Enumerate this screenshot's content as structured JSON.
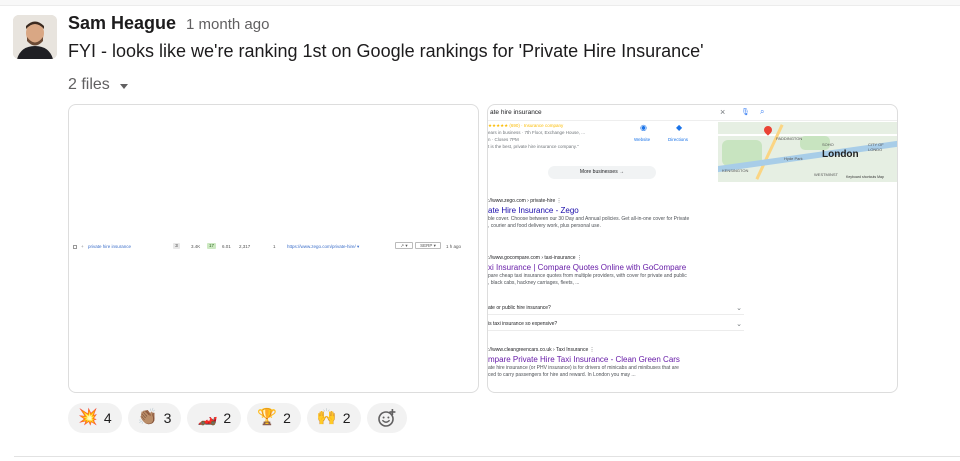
{
  "message": {
    "author": "Sam Heague",
    "timestamp": "1 month ago",
    "text": "FYI - looks like we're ranking 1st on Google rankings for 'Private Hire Insurance'",
    "files_label": "2 files"
  },
  "file1": {
    "keyword": "private hire insurance",
    "kd": "3",
    "volume": "3.4K",
    "tp": "17",
    "cpc": "6.01",
    "traffic": "2,317",
    "position": "1",
    "url": "https://www.zego.com/private-hire/ ▾",
    "chart_btn": "↗ ▾",
    "serp_btn": "SERP ▾",
    "updated": "1 h ago"
  },
  "file2": {
    "query": "ate hire insurance",
    "clear_icon": "×",
    "place_rating_line": "★★★★★ (690) · Insurance company",
    "place_line2": "ears in business · 7th Floor, Exchange House, ...",
    "place_line3": "n · Closes 7PM",
    "place_line4": "t is the best, private hire insurance company.\"",
    "website": "Website",
    "directions": "Directions",
    "more_businesses": "More businesses →",
    "map_labels": {
      "london": "London",
      "paddington": "PADDINGTON",
      "soho": "SOHO",
      "city": "CITY OF LONDO",
      "kensington": "KENSINGTON",
      "hyde": "Hyde Park",
      "westminster": "WESTMINST",
      "keyboard": "Keyboard shortcuts  Map"
    },
    "results": [
      {
        "cite": "://www.zego.com › private-hire   ⋮",
        "title": "ate Hire Insurance - Zego",
        "snippet1": "ble cover. Choose between our 30 Day and Annual policies. Get all-in-one cover for Private",
        "snippet2": ", courier and food delivery work, plus personal use."
      },
      {
        "cite": "://www.gocompare.com › taxi-insurance   ⋮",
        "title": "xi Insurance | Compare Quotes Online with GoCompare",
        "snippet1": "pare cheap taxi insurance quotes from multiple providers, with cover for private and public",
        "snippet2": ", black cabs, hackney carriages, fleets, ..."
      },
      {
        "cite": "://www.cleangreencars.co.uk › Taxi Insurance   ⋮",
        "title": "mpare Private Hire Taxi Insurance - Clean Green Cars",
        "snippet1": "ate hire insurance (or PHV insurance) is for drivers of minicabs and minibuses that are",
        "snippet2": "ced to carry passengers for hire and reward. In London you may ..."
      }
    ],
    "faqs": [
      "ate or public hire insurance?",
      "is taxi insurance so expensive?"
    ]
  },
  "reactions": [
    {
      "emoji": "💥",
      "name": "boom",
      "count": "4"
    },
    {
      "emoji": "👏🏽",
      "name": "clap",
      "count": "3"
    },
    {
      "emoji": "🏎️",
      "name": "racing-car",
      "count": "2"
    },
    {
      "emoji": "🏆",
      "name": "trophy",
      "count": "2"
    },
    {
      "emoji": "🙌",
      "name": "raised-hands",
      "count": "2"
    }
  ],
  "add_reaction_icon": "add-reaction-icon"
}
